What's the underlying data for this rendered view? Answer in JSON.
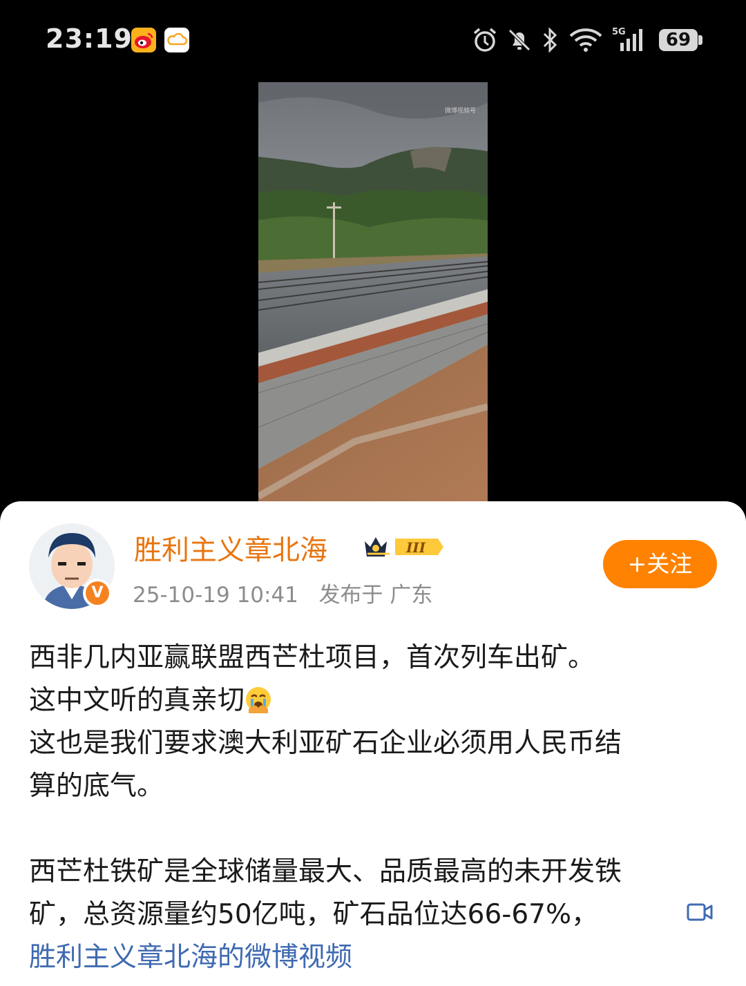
{
  "status_bar": {
    "time": "23:19",
    "app_icons": [
      "weibo-icon",
      "weather-icon"
    ],
    "system_icons": [
      "alarm-icon",
      "mute-icon",
      "bluetooth-icon",
      "wifi-icon",
      "5g-signal-icon"
    ],
    "network": "5G",
    "battery": "69"
  },
  "video": {
    "watermark": "微博视频号"
  },
  "post": {
    "username": "胜利主义章北海",
    "level_badge": "III",
    "timestamp": "25-10-19 10:41",
    "location": "发布于 广东",
    "follow_label": "+关注",
    "lines": [
      "西非几内亚赢联盟西芒杜项目，首次列车出矿。",
      "这中文听的真亲切",
      "这也是我们要求澳大利亚矿石企业必须用人民币结",
      "算的底气。",
      "西芒杜铁矿是全球储量最大、品质最高的未开发铁",
      "矿，总资源量约50亿吨，矿石品位达66-67%，"
    ],
    "video_link": "胜利主义章北海的微博视频"
  },
  "colors": {
    "accent_orange": "#ff8200",
    "username": "#e8750f",
    "link_blue": "#3f6ab1"
  }
}
